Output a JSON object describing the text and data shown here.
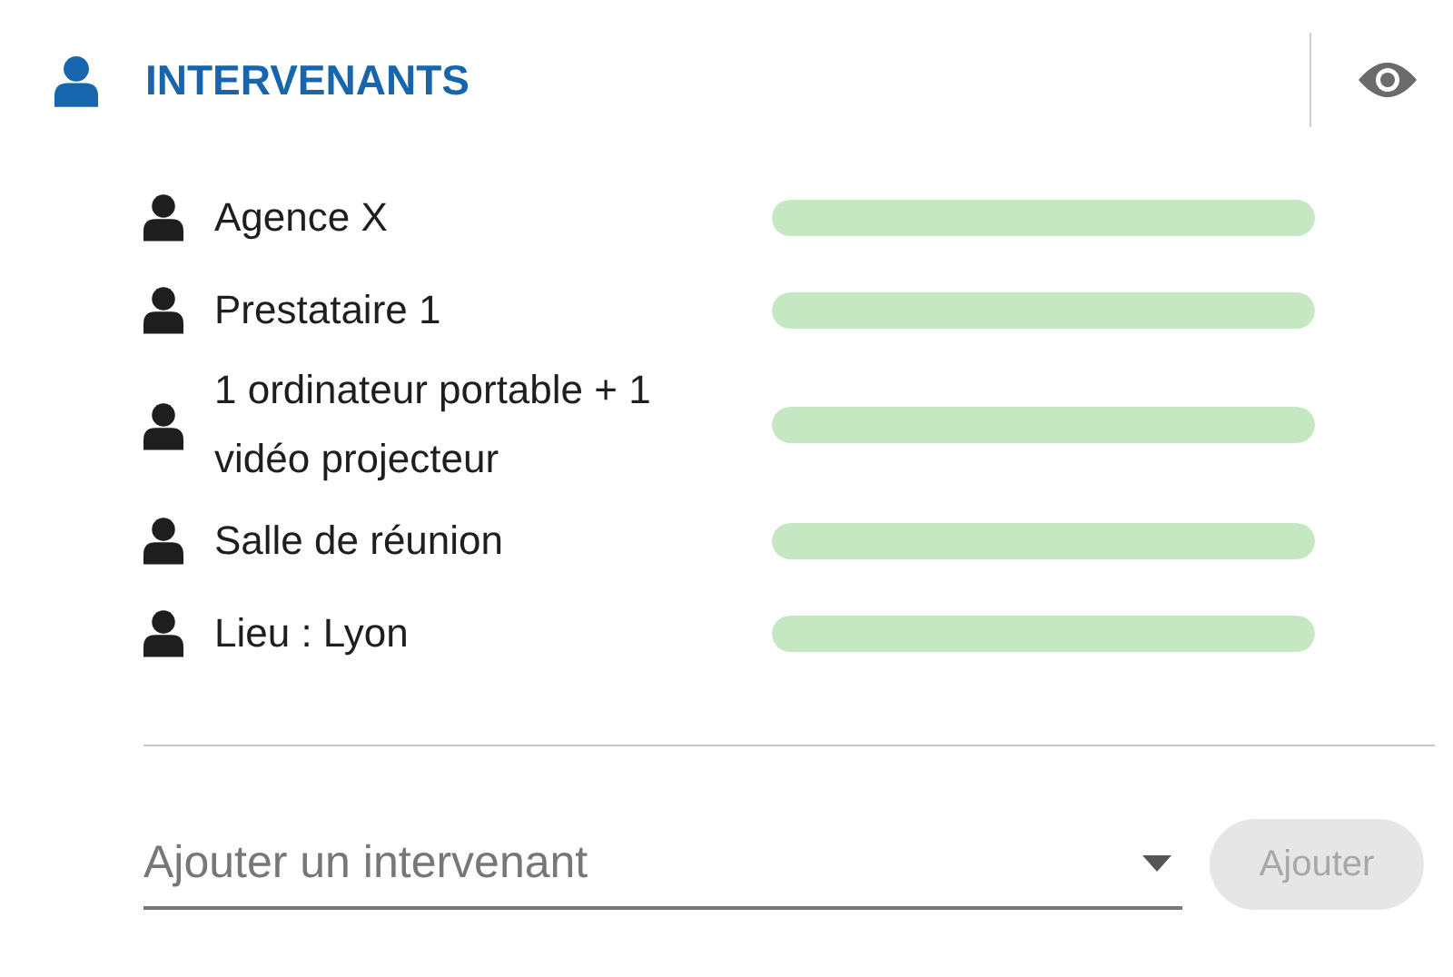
{
  "section": {
    "title": "INTERVENANTS"
  },
  "items": [
    {
      "label": "Agence X",
      "level": 1
    },
    {
      "label": "Prestataire 1",
      "level": 1
    },
    {
      "label": "1 ordinateur portable + 1 vidéo projecteur",
      "level": 1
    },
    {
      "label": "Salle de réunion",
      "level": 1
    },
    {
      "label": "Lieu : Lyon",
      "level": 1
    }
  ],
  "add": {
    "placeholder": "Ajouter un intervenant",
    "button": "Ajouter",
    "disabled": true
  }
}
